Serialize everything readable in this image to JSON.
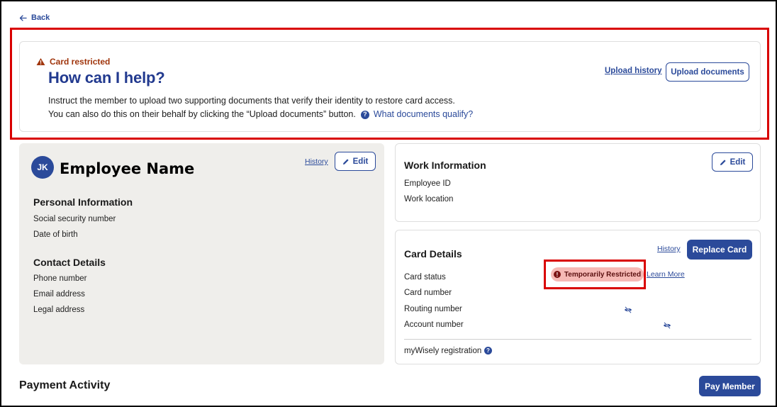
{
  "nav": {
    "back_label": "Back"
  },
  "banner": {
    "eyebrow": "Card restricted",
    "title": "How can I help?",
    "line1": "Instruct the member to upload two supporting documents that verify their identity to restore card access.",
    "line2": "You can also do this on their behalf by clicking the “Upload documents” button.",
    "help_link": "What documents qualify?",
    "upload_history_label": "Upload history",
    "upload_documents_label": "Upload documents"
  },
  "employee": {
    "initials": "JK",
    "name": "Employee Name",
    "history_label": "History",
    "edit_label": "Edit",
    "personal_title": "Personal Information",
    "personal_fields": [
      "Social security number",
      "Date of birth"
    ],
    "contact_title": "Contact Details",
    "contact_fields": [
      "Phone number",
      "Email address",
      "Legal address"
    ]
  },
  "work": {
    "title": "Work Information",
    "edit_label": "Edit",
    "fields": [
      "Employee ID",
      "Work location"
    ]
  },
  "card": {
    "title": "Card Details",
    "history_label": "History",
    "replace_label": "Replace Card",
    "fields": [
      "Card status",
      "Card number",
      "Routing number",
      "Account number"
    ],
    "status_value": "Temporarily Restricted",
    "learn_more_label": "Learn More",
    "registration_label": "myWisely registration"
  },
  "payment": {
    "title": "Payment Activity",
    "pay_member_label": "Pay Member"
  },
  "colors": {
    "brand_blue": "#2b4a9a",
    "highlight_red": "#d90000",
    "warning_orange": "#a0350c",
    "restricted_badge": "#f6b9b5"
  }
}
